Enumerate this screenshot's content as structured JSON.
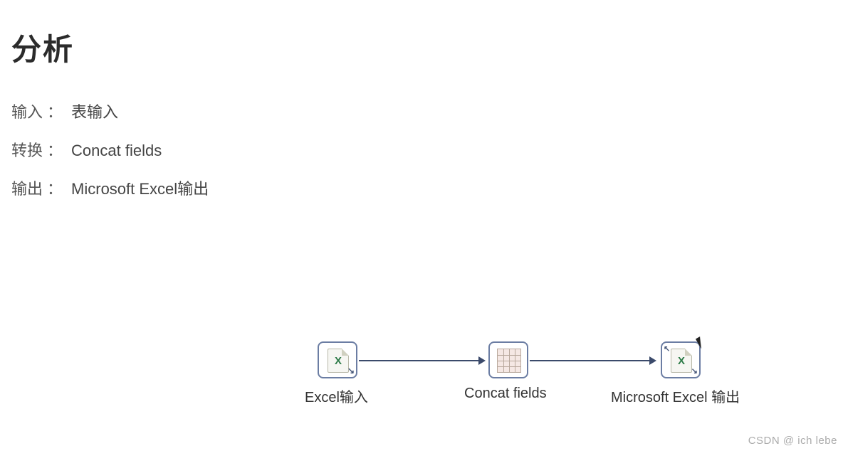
{
  "title": "分析",
  "specs": {
    "input": {
      "label": "输入",
      "value": "表输入"
    },
    "transform": {
      "label": "转换",
      "value": "Concat fields"
    },
    "output": {
      "label": "输出",
      "value": "Microsoft Excel输出"
    }
  },
  "separator": "：",
  "diagram": {
    "nodes": [
      {
        "id": "excel-input",
        "label": "Excel输入"
      },
      {
        "id": "concat-fields",
        "label": "Concat fields"
      },
      {
        "id": "excel-output",
        "label": "Microsoft Excel 输出"
      }
    ]
  },
  "excel_marker": "X",
  "watermark": "CSDN @ ich lebe"
}
